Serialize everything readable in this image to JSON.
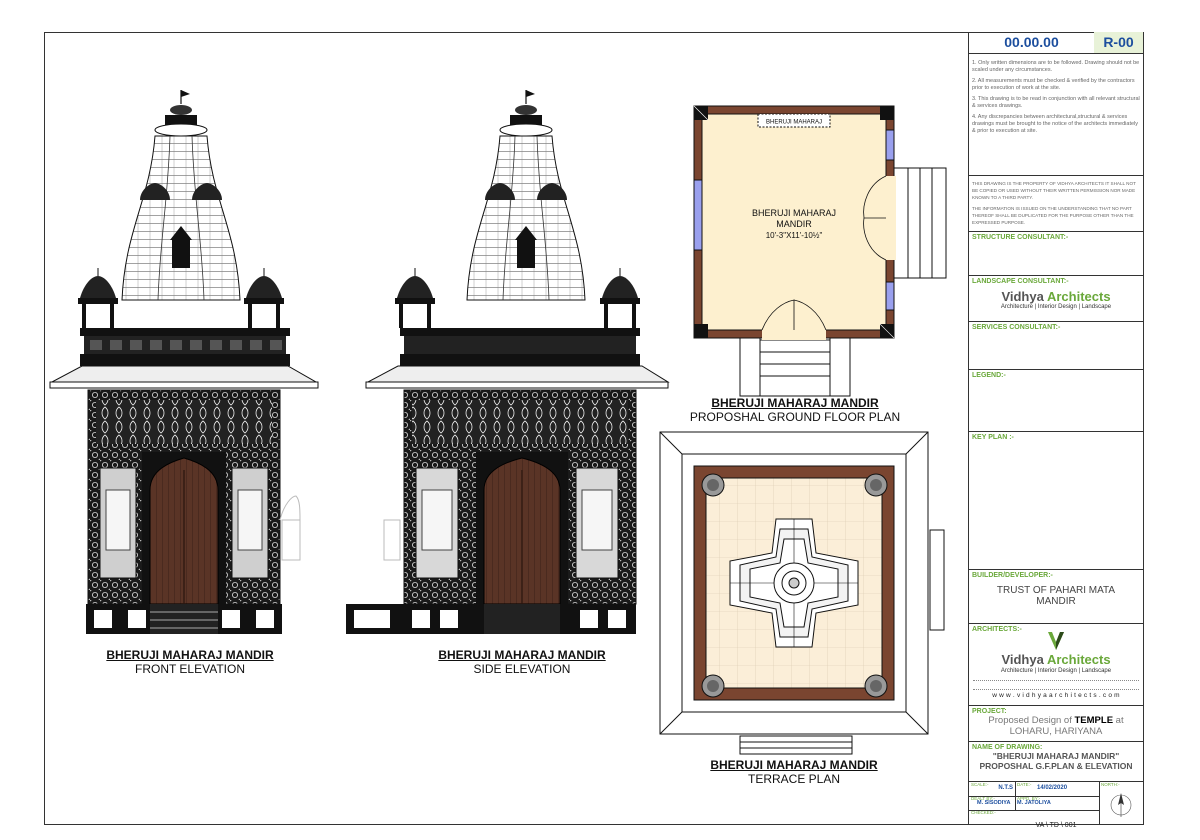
{
  "captions": {
    "front": {
      "title": "BHERUJI MAHARAJ MANDIR",
      "sub": "FRONT ELEVATION"
    },
    "side": {
      "title": "BHERUJI MAHARAJ MANDIR",
      "sub": "SIDE ELEVATION"
    },
    "plan": {
      "title": "BHERUJI MAHARAJ MANDIR",
      "sub": "PROPOSHAL GROUND FLOOR PLAN"
    },
    "terrace": {
      "title": "BHERUJI MAHARAJ MANDIR",
      "sub": "TERRACE PLAN"
    }
  },
  "plan": {
    "signboard": "BHERUJI MAHARAJ",
    "room_name_1": "BHERUJI MAHARAJ",
    "room_name_2": "MANDIR",
    "room_size": "10'-3\"X11'-10½\""
  },
  "titleblock": {
    "date_code": "00.00.00",
    "revision": "R-00",
    "notes": [
      "1. Only written dimensions are to be followed. Drawing should not be scaled under any circumstances.",
      "2. All measurements must be checked & verified by the contractors prior to execution of work at the site.",
      "3. This drawing is to be read in conjunction with all relevant structural & services drawings.",
      "4. Any discrepancies between architectural,structural & services drawings must be brought to the notice of the architects immediately & prior to execution at site."
    ],
    "property_1": "THIS DRAWING IS THE PROPERTY OF VIDHYA ARCHITECTS IT SHALL NOT BE COPIED OR USED WITHOUT THEIR WRITTEN PERMISSION NOR MADE KNOWN TO A THIRD PARTY.",
    "property_2": "THE INFORMATION IS ISSUED ON THE UNDERSTANDING THAT NO PART THEREOF SHALL BE DUPLICATED FOR THE PURPOSE OTHER THAN THE EXPRESSED PURPOSE.",
    "structure_consultant": "STRUCTURE  CONSULTANT:-",
    "landscape_consultant": "LANDSCAPE CONSULTANT:-",
    "firm_a": "Vidhya ",
    "firm_b": "Architects",
    "firm_tagline": "Architecture | Interior Design | Landscape",
    "services_consultant": "SERVICES CONSULTANT:-",
    "legend": "LEGEND:-",
    "key_plan": "KEY PLAN :-",
    "builder_label": "BUILDER/DEVELOPER:-",
    "builder_1": "TRUST OF PAHARI MATA",
    "builder_2": "MANDIR",
    "architects_label": "ARCHITECTS:-",
    "website": "w w w . v i d h y a a r c h i t e c t s . c o m",
    "project_label": "PROJECT:",
    "project_1a": "Proposed Design of ",
    "project_1b": "TEMPLE",
    "project_1c": " at",
    "project_2": "LOHARU, HARIYANA",
    "drawing_label": "NAME OF DRAWING:",
    "drawing_1": "\"BHERUJI MAHARAJ MANDIR\"",
    "drawing_2": "PROPOSHAL G.F.PLAN & ELEVATION",
    "scale_label": "SCALE:-",
    "scale": "N.T.S",
    "date_label": "DATE:-",
    "date": "14/02/2020",
    "north_label": "NORTH:-",
    "drawn_label": "DEALT BY:-",
    "drawn": "M. SISODIYA",
    "approved_label": "APPD. BY:-",
    "approved": "M. JATOLIYA",
    "checked_label": "CHECKED:-",
    "sheet_no": "VA \\ TD \\ 001"
  },
  "colors": {
    "wall": "#7a4530",
    "floor": "#fdf0cf",
    "window": "#9aa0ee",
    "door_wood": "#5a3426",
    "accent_green": "#6aa83a",
    "revision_bg": "#e8f2d8"
  }
}
